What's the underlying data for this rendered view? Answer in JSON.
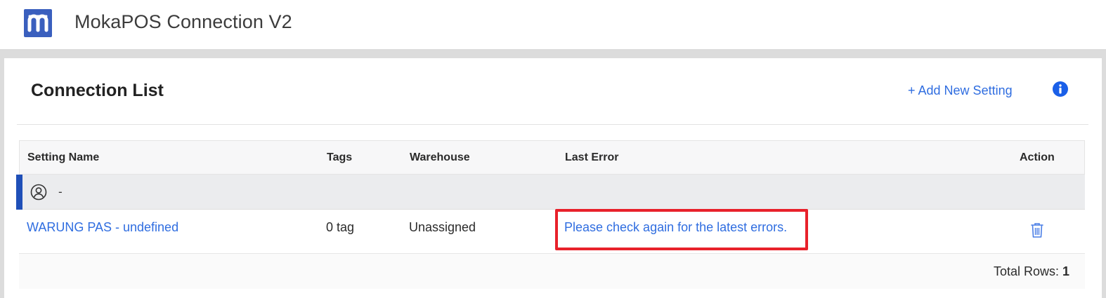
{
  "app": {
    "title": "MokaPOS Connection V2",
    "logo_icon": "moka-logo-icon",
    "brand_color": "#3a5fbe"
  },
  "card": {
    "title": "Connection List",
    "add_label": "+ Add New Setting",
    "info_icon": "info-icon",
    "accent_color": "#2f6de0"
  },
  "table": {
    "headers": {
      "setting_name": "Setting Name",
      "tags": "Tags",
      "warehouse": "Warehouse",
      "last_error": "Last Error",
      "action": "Action"
    },
    "group": {
      "icon": "user-circle-icon",
      "label": "-"
    },
    "rows": [
      {
        "setting_name": "WARUNG PAS - undefined",
        "tags": "0 tag",
        "warehouse": "Unassigned",
        "last_error": "Please check again for the latest errors.",
        "action_icon": "trash-icon"
      }
    ],
    "footer": {
      "total_label": "Total Rows: ",
      "total_value": "1"
    }
  },
  "highlight_color": "#e8212b"
}
